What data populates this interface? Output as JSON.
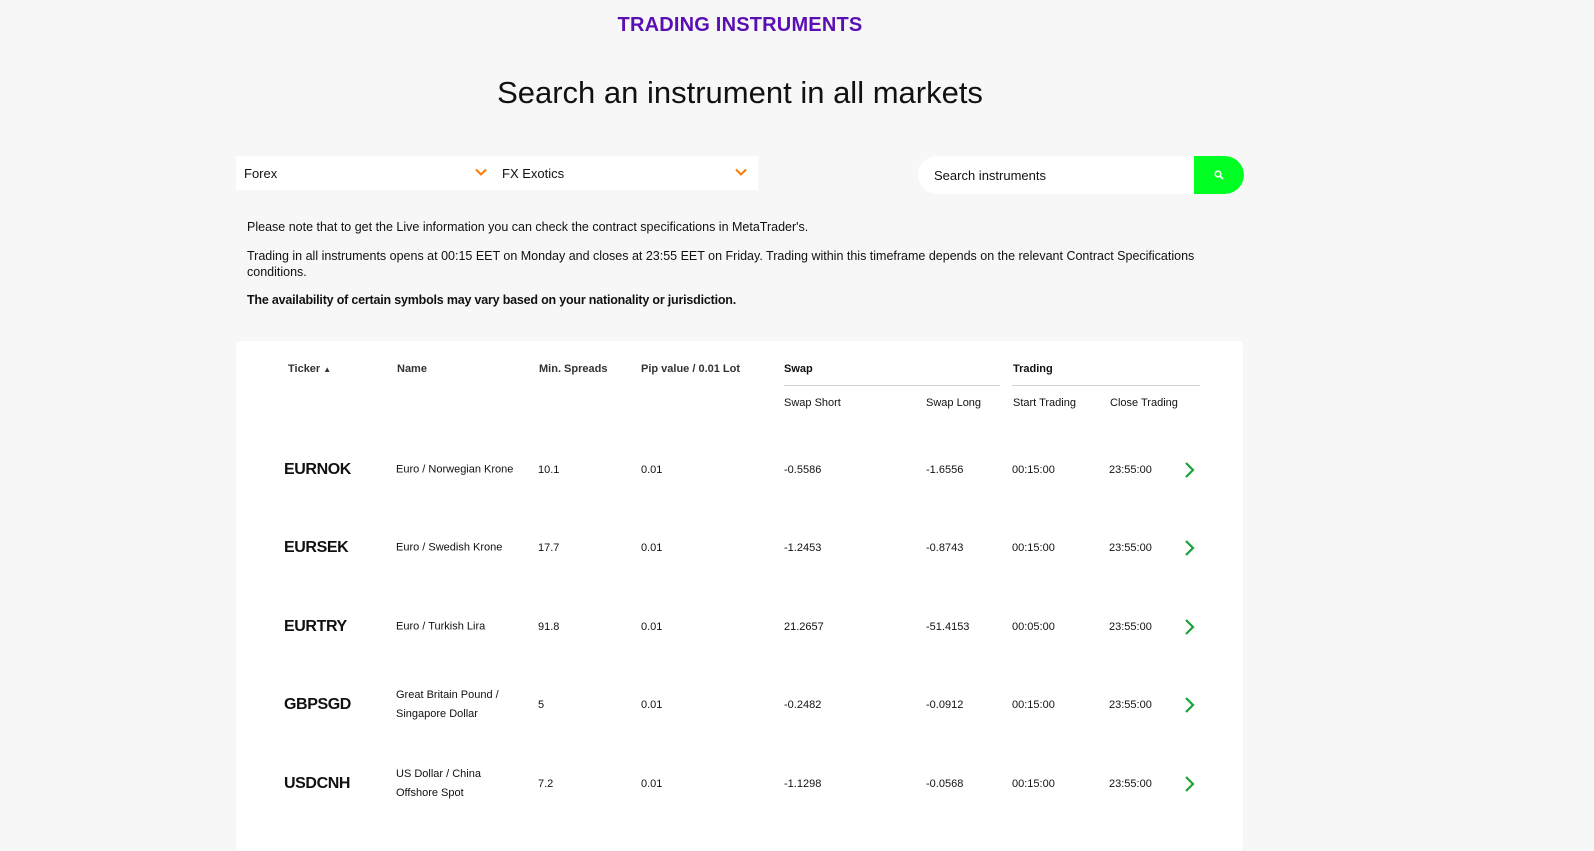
{
  "header": {
    "eyebrow": "TRADING INSTRUMENTS",
    "title": "Search an instrument in all markets"
  },
  "filters": {
    "market": "Forex",
    "category": "FX Exotics"
  },
  "search": {
    "placeholder": "Search instruments",
    "icon": "search-icon"
  },
  "notices": {
    "live_info": "Please note that to get the Live information you can check the contract specifications in MetaTrader's.",
    "trading_hours": "Trading in all instruments opens at 00:15 EET on Monday and closes at 23:55 EET on Friday. Trading within this timeframe depends on the relevant Contract Specifications conditions.",
    "availability": "The availability of certain symbols may vary based on your nationality or jurisdiction."
  },
  "table": {
    "columns": {
      "ticker": "Ticker",
      "ticker_sort_glyph": "▲",
      "name": "Name",
      "min_spreads": "Min. Spreads",
      "pip_value": "Pip value / 0.01 Lot",
      "swap": "Swap",
      "trading": "Trading",
      "swap_short": "Swap Short",
      "swap_long": "Swap Long",
      "start_trading": "Start Trading",
      "close_trading": "Close Trading"
    },
    "rows": [
      {
        "ticker": "EURNOK",
        "name": "Euro / Norwegian Krone",
        "min_spreads": "10.1",
        "pip_value": "0.01",
        "swap_short": "-0.5586",
        "swap_long": "-1.6556",
        "start": "00:15:00",
        "close": "23:55:00"
      },
      {
        "ticker": "EURSEK",
        "name": "Euro / Swedish Krone",
        "min_spreads": "17.7",
        "pip_value": "0.01",
        "swap_short": "-1.2453",
        "swap_long": "-0.8743",
        "start": "00:15:00",
        "close": "23:55:00"
      },
      {
        "ticker": "EURTRY",
        "name": "Euro / Turkish Lira",
        "min_spreads": "91.8",
        "pip_value": "0.01",
        "swap_short": "21.2657",
        "swap_long": "-51.4153",
        "start": "00:05:00",
        "close": "23:55:00"
      },
      {
        "ticker": "GBPSGD",
        "name": "Great Britain Pound / Singapore Dollar",
        "min_spreads": "5",
        "pip_value": "0.01",
        "swap_short": "-0.2482",
        "swap_long": "-0.0912",
        "start": "00:15:00",
        "close": "23:55:00"
      },
      {
        "ticker": "USDCNH",
        "name": "US Dollar / China Offshore Spot",
        "min_spreads": "7.2",
        "pip_value": "0.01",
        "swap_short": "-1.1298",
        "swap_long": "-0.0568",
        "start": "00:15:00",
        "close": "23:55:00"
      }
    ]
  },
  "colors": {
    "eyebrow": "#5b0fb3",
    "accent_orange": "#ff7a00",
    "search_button": "#00ff22",
    "row_arrow": "#1aa33a"
  }
}
